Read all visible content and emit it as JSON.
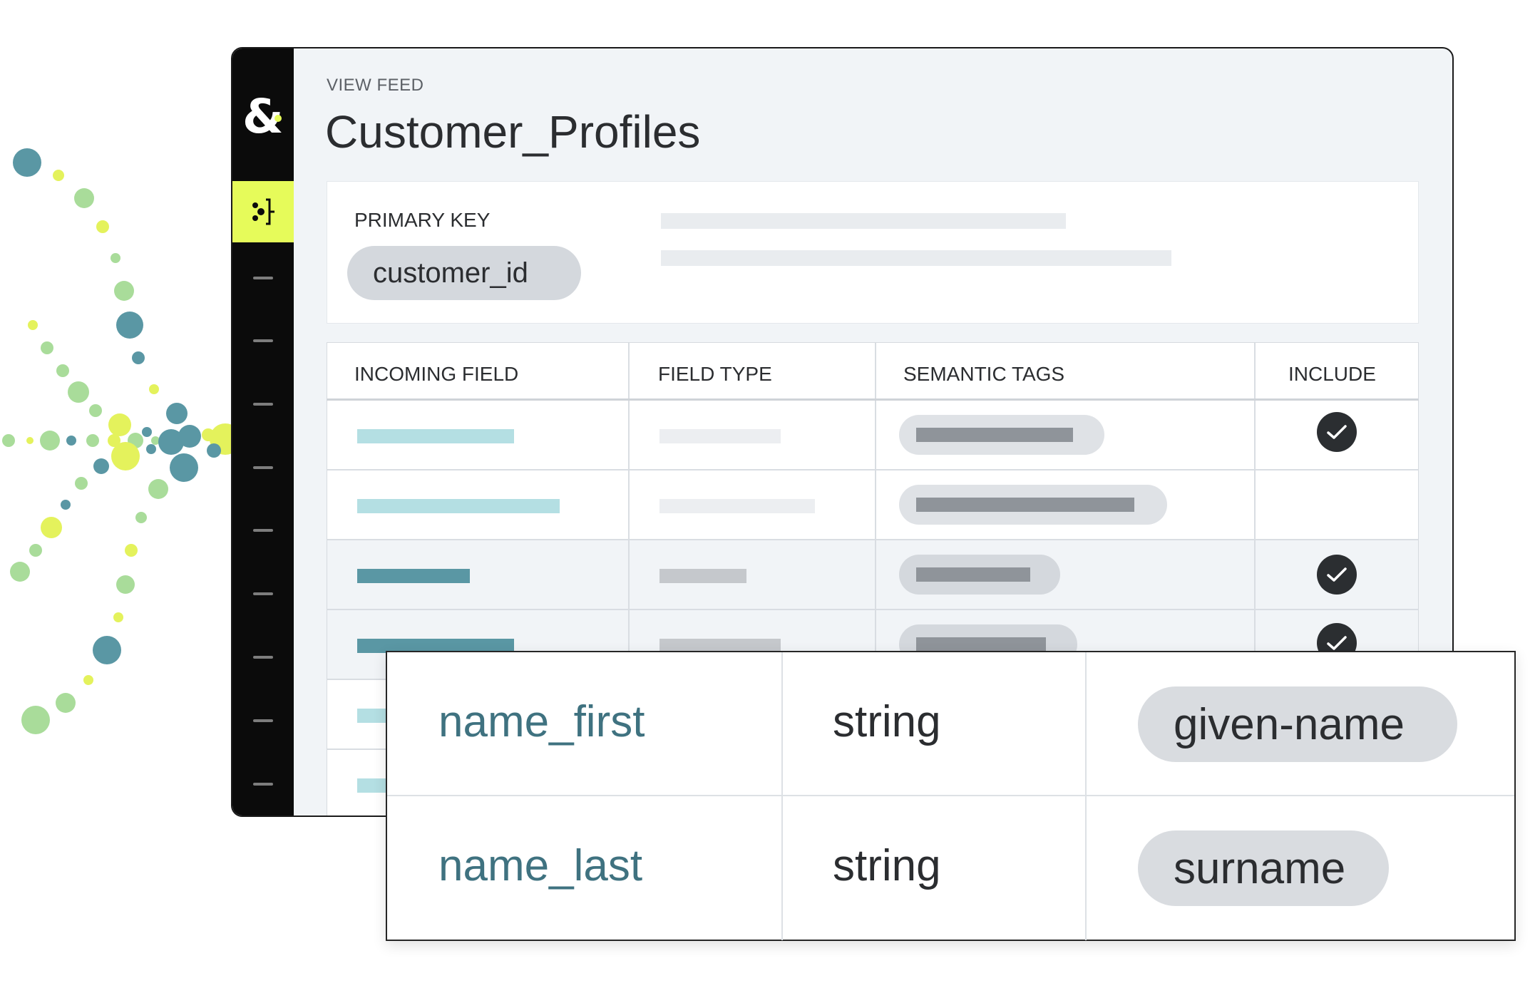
{
  "header": {
    "eyebrow": "VIEW FEED",
    "title": "Customer_Profiles"
  },
  "primary_key": {
    "label": "PRIMARY KEY",
    "value": "customer_id"
  },
  "table": {
    "columns": [
      "INCOMING FIELD",
      "FIELD TYPE",
      "SEMANTIC TAGS",
      "INCLUDE"
    ],
    "rows": [
      {
        "include": true
      },
      {
        "include": false
      },
      {
        "include": true
      },
      {
        "include": true
      }
    ]
  },
  "overlay": {
    "rows": [
      {
        "field": "name_first",
        "type": "string",
        "tag": "given-name"
      },
      {
        "field": "name_last",
        "type": "string",
        "tag": "surname"
      }
    ]
  },
  "icons": {
    "logo": "ampersand-logo-icon",
    "active_nav": "feed-connector-icon",
    "check": "check-circle-icon"
  },
  "colors": {
    "accent": "#e6fb5a",
    "teal": "#5a97a4",
    "light_teal": "#b4dfe3",
    "sidebar": "#0b0b0b",
    "field_text": "#3f7280"
  }
}
